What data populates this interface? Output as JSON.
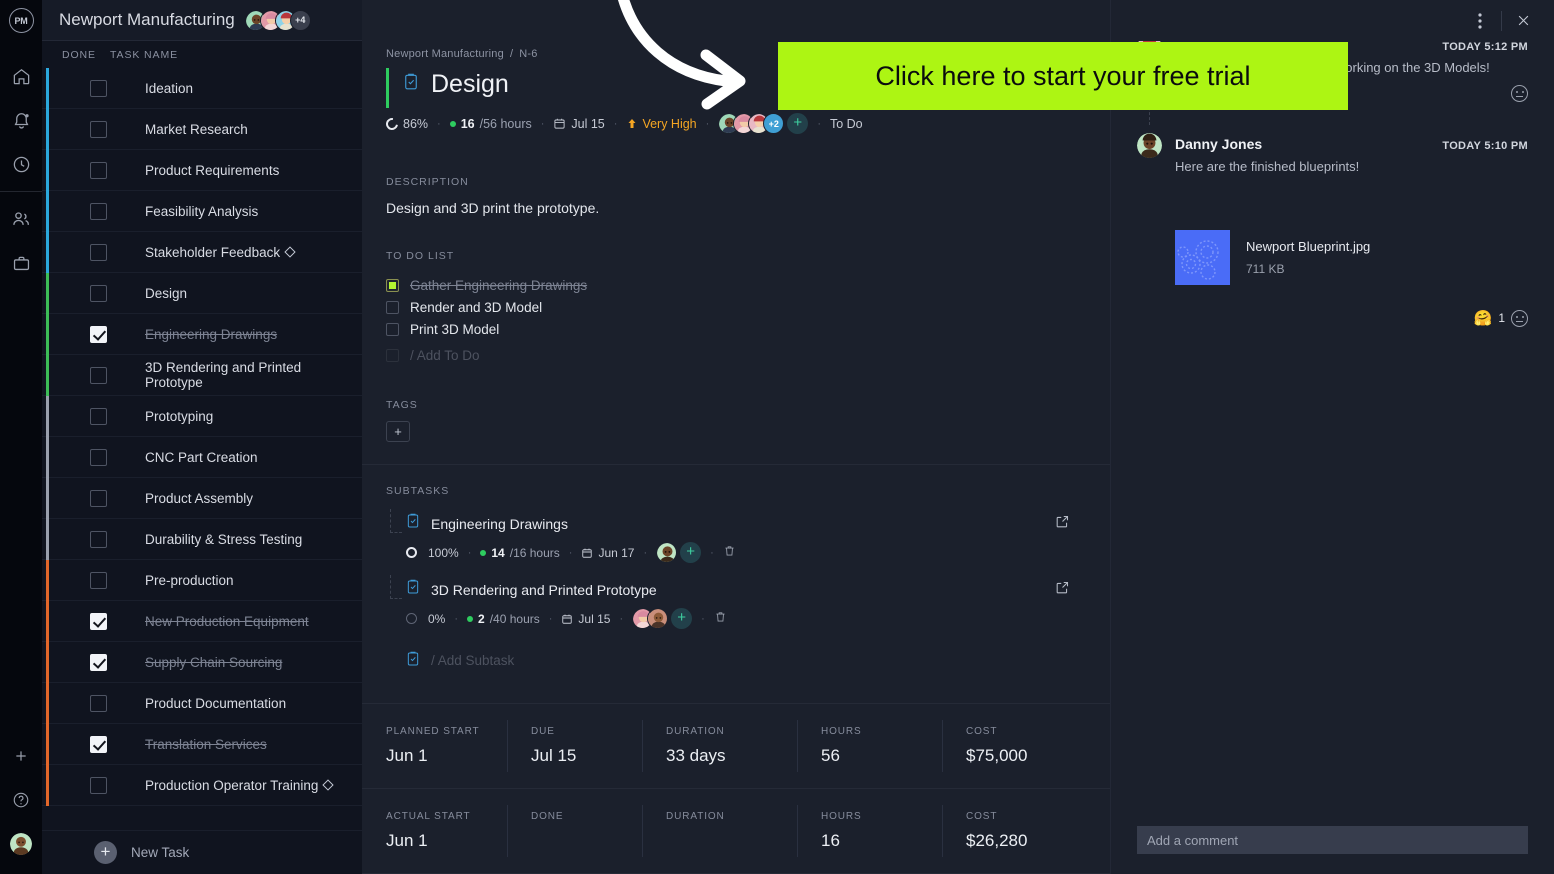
{
  "rail": {
    "logo_text": "PM",
    "icons": [
      "home-icon",
      "bell-icon",
      "clock-icon",
      "people-icon",
      "briefcase-icon"
    ],
    "bottom_icons": [
      "plus-icon",
      "help-icon",
      "user-avatar"
    ]
  },
  "list_panel": {
    "project_title": "Newport Manufacturing",
    "avatar_overflow": "+4",
    "columns": {
      "done": "DONE",
      "task_name": "TASK NAME"
    },
    "new_task_label": "New Task",
    "tasks": [
      {
        "name": "Ideation",
        "done": false,
        "bar": "#2ba8dd",
        "milestone": false
      },
      {
        "name": "Market Research",
        "done": false,
        "bar": "#2ba8dd",
        "milestone": false
      },
      {
        "name": "Product Requirements",
        "done": false,
        "bar": "#2ba8dd",
        "milestone": false
      },
      {
        "name": "Feasibility Analysis",
        "done": false,
        "bar": "#2ba8dd",
        "milestone": false
      },
      {
        "name": "Stakeholder Feedback",
        "done": false,
        "bar": "#2ba8dd",
        "milestone": true
      },
      {
        "name": "Design",
        "done": false,
        "bar": "#3dbd57",
        "milestone": false
      },
      {
        "name": "Engineering Drawings",
        "done": true,
        "bar": "#3dbd57",
        "milestone": false
      },
      {
        "name": "3D Rendering and Printed Prototype",
        "done": false,
        "bar": "#3dbd57",
        "milestone": false
      },
      {
        "name": "Prototyping",
        "done": false,
        "bar": "#9aa0ad",
        "milestone": false
      },
      {
        "name": "CNC Part Creation",
        "done": false,
        "bar": "#9aa0ad",
        "milestone": false
      },
      {
        "name": "Product Assembly",
        "done": false,
        "bar": "#9aa0ad",
        "milestone": false
      },
      {
        "name": "Durability & Stress Testing",
        "done": false,
        "bar": "#9aa0ad",
        "milestone": false
      },
      {
        "name": "Pre-production",
        "done": false,
        "bar": "#e2672a",
        "milestone": false
      },
      {
        "name": "New Production Equipment",
        "done": true,
        "bar": "#e2672a",
        "milestone": false
      },
      {
        "name": "Supply Chain Sourcing",
        "done": true,
        "bar": "#e2672a",
        "milestone": false
      },
      {
        "name": "Product Documentation",
        "done": false,
        "bar": "#e2672a",
        "milestone": false
      },
      {
        "name": "Translation Services",
        "done": true,
        "bar": "#e2672a",
        "milestone": false
      },
      {
        "name": "Production Operator Training",
        "done": false,
        "bar": "#e2672a",
        "milestone": true
      }
    ]
  },
  "detail": {
    "breadcrumb_project": "Newport Manufacturing",
    "breadcrumb_sep": "/",
    "breadcrumb_id": "N-6",
    "title": "Design",
    "meta": {
      "progress": "86%",
      "hours_used": "16",
      "hours_total": "/56 hours",
      "due_date": "Jul 15",
      "priority": "Very High",
      "avatar_overflow": "+2",
      "status": "To Do"
    },
    "description_label": "DESCRIPTION",
    "description_text": "Design and 3D print the prototype.",
    "todo_label": "TO DO LIST",
    "todos": [
      {
        "text": "Gather Engineering Drawings",
        "done": true
      },
      {
        "text": "Render and 3D Model",
        "done": false
      },
      {
        "text": "Print 3D Model",
        "done": false
      }
    ],
    "add_todo_label": "/ Add To Do",
    "tags_label": "TAGS",
    "subtasks_label": "SUBTASKS",
    "subtasks": [
      {
        "title": "Engineering Drawings",
        "progress": "100%",
        "hours_used": "14",
        "hours_total": "/16 hours",
        "date": "Jun 17"
      },
      {
        "title": "3D Rendering and Printed Prototype",
        "progress": "0%",
        "hours_used": "2",
        "hours_total": "/40 hours",
        "date": "Jul 15"
      }
    ],
    "add_subtask_label": "/ Add Subtask",
    "stats_planned": [
      {
        "label": "PLANNED START",
        "value": "Jun 1"
      },
      {
        "label": "DUE",
        "value": "Jul 15"
      },
      {
        "label": "DURATION",
        "value": "33 days"
      },
      {
        "label": "HOURS",
        "value": "56"
      },
      {
        "label": "COST",
        "value": "$75,000"
      }
    ],
    "stats_actual": [
      {
        "label": "ACTUAL START",
        "value": "Jun 1"
      },
      {
        "label": "DONE",
        "value": ""
      },
      {
        "label": "DURATION",
        "value": ""
      },
      {
        "label": "HOURS",
        "value": "16"
      },
      {
        "label": "COST",
        "value": "$26,280"
      }
    ]
  },
  "comments": {
    "entries": [
      {
        "name": "",
        "time": "TODAY 5:12 PM",
        "text": "Thanks Danny, we will start working on the 3D Models!"
      },
      {
        "name": "Danny Jones",
        "time": "TODAY 5:10 PM",
        "text": "Here are the finished blueprints!"
      }
    ],
    "attachment": {
      "name": "Newport Blueprint.jpg",
      "size": "711 KB"
    },
    "reaction_count": "1",
    "input_placeholder": "Add a comment"
  },
  "overlay": {
    "cta_text": "Click here to start your free trial",
    "cta_color": "#adf513"
  }
}
